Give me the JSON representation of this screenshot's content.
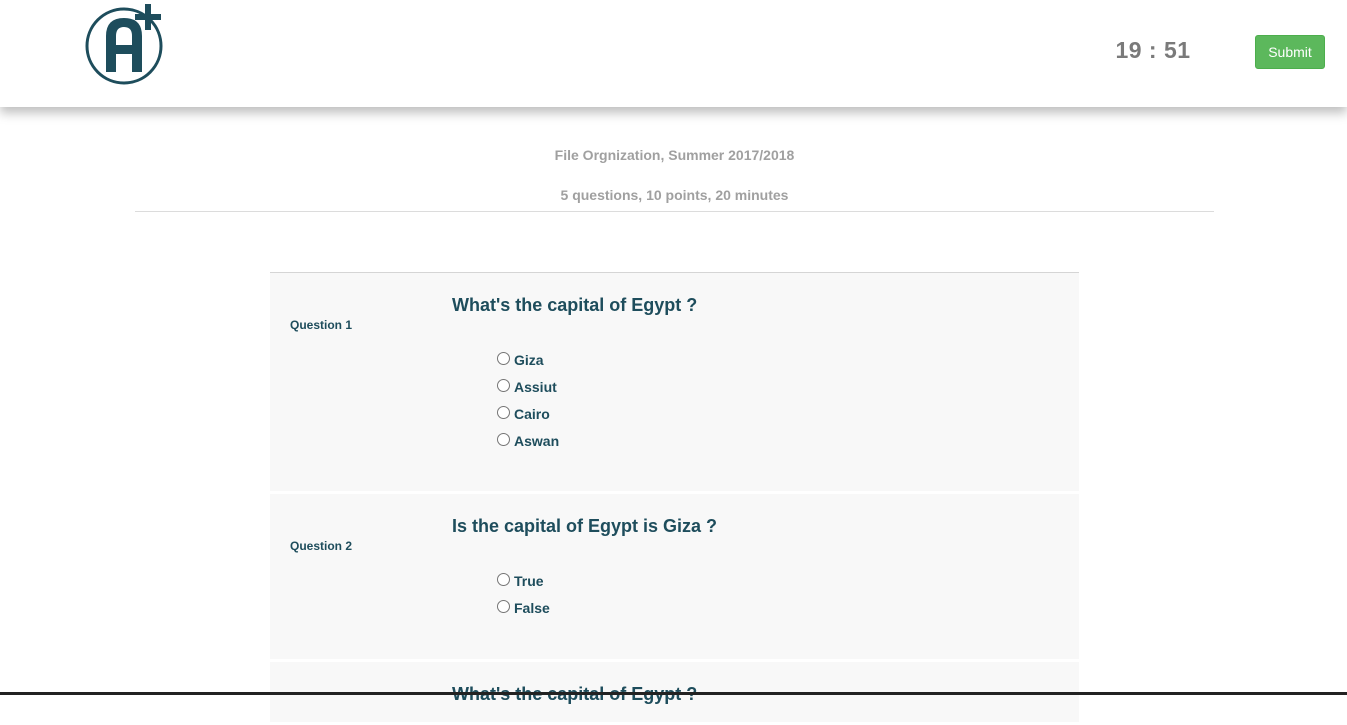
{
  "header": {
    "logo_icon": "a-plus-logo-icon",
    "timer": "19 : 51",
    "submit_label": "Submit",
    "submit_color": "#5cb85c",
    "brand_color": "#1e4d5c"
  },
  "exam": {
    "title": "File Orgnization, Summer 2017/2018",
    "meta": "5 questions, 10 points, 20 minutes"
  },
  "questions": [
    {
      "label": "Question 1",
      "text": "What's the capital of Egypt ?",
      "options": [
        "Giza",
        "Assiut",
        "Cairo",
        "Aswan"
      ]
    },
    {
      "label": "Question 2",
      "text": "Is the capital of Egypt is Giza ?",
      "options": [
        "True",
        "False"
      ]
    },
    {
      "label": "",
      "text": "What's the capital of Egypt ?",
      "options": []
    }
  ]
}
